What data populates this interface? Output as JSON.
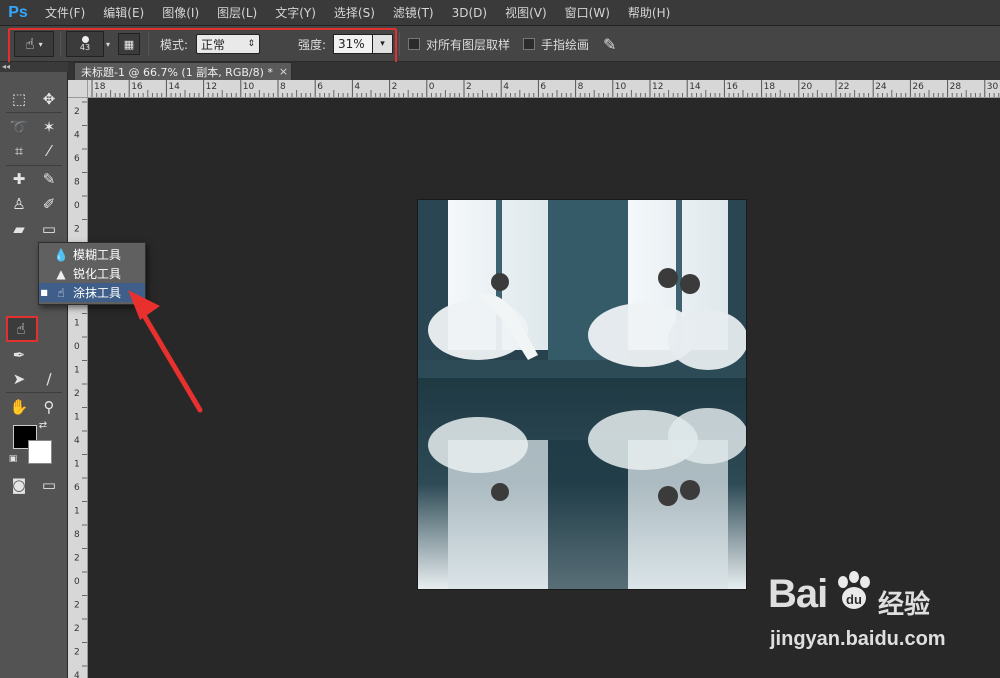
{
  "app": {
    "logo": "Ps"
  },
  "menu": [
    "文件(F)",
    "编辑(E)",
    "图像(I)",
    "图层(L)",
    "文字(Y)",
    "选择(S)",
    "滤镜(T)",
    "3D(D)",
    "视图(V)",
    "窗口(W)",
    "帮助(H)"
  ],
  "options": {
    "brush_size": "43",
    "mode_label": "模式:",
    "mode_value": "正常",
    "strength_label": "强度:",
    "strength_value": "31%",
    "sample_all_layers": "对所有图层取样",
    "finger_painting": "手指绘画"
  },
  "document": {
    "tab_title": "未标题-1 @ 66.7% (1 副本, RGB/8) *",
    "tab_close": "×"
  },
  "ruler_top": [
    "18",
    "16",
    "14",
    "12",
    "10",
    "8",
    "6",
    "4",
    "2",
    "0",
    "2",
    "4",
    "6",
    "8",
    "10",
    "12",
    "14",
    "16",
    "18",
    "20",
    "22",
    "24",
    "26",
    "28",
    "30"
  ],
  "ruler_left": [
    "2",
    "4",
    "6",
    "8",
    "0",
    "2",
    "4",
    "6",
    "8",
    "1",
    "0",
    "1",
    "2",
    "1",
    "4",
    "1",
    "6",
    "1",
    "8",
    "2",
    "0",
    "2",
    "2",
    "2",
    "4"
  ],
  "flyout": {
    "items": [
      {
        "label": "模糊工具",
        "icon": "water-drop-icon",
        "selected": false
      },
      {
        "label": "锐化工具",
        "icon": "triangle-icon",
        "selected": false
      },
      {
        "label": "涂抹工具",
        "icon": "finger-smudge-icon",
        "selected": true
      }
    ]
  },
  "colors": {
    "highlight": "#e03030",
    "foreground": "#000000",
    "background": "#ffffff"
  },
  "watermark": {
    "logo": "Bai",
    "cn": "经验",
    "url": "jingyan.baidu.com"
  }
}
